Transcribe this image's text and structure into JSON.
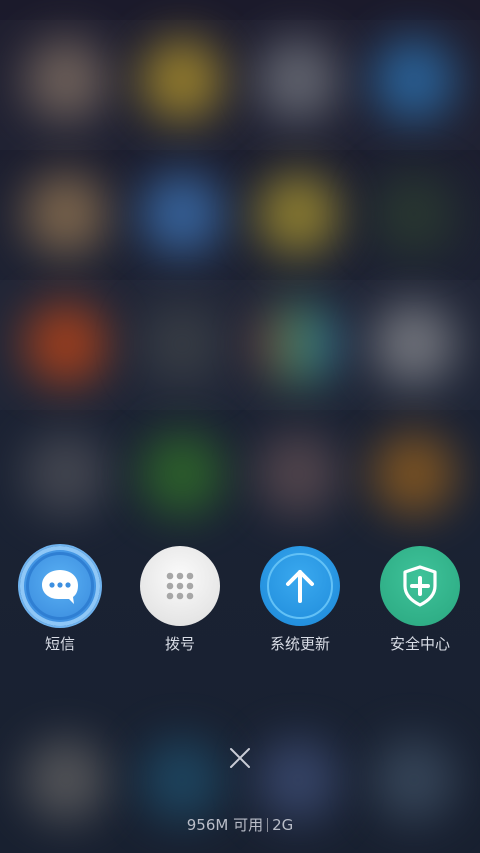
{
  "recent_apps": [
    {
      "label": "短信",
      "icon": "message-bubble-icon",
      "color": "#3d8fe0"
    },
    {
      "label": "拨号",
      "icon": "dialpad-icon",
      "color": "#e6e6e6"
    },
    {
      "label": "系统更新",
      "icon": "arrow-up-icon",
      "color": "#2390de"
    },
    {
      "label": "安全中心",
      "icon": "shield-plus-icon",
      "color": "#2fae86"
    }
  ],
  "close": {
    "label": "×",
    "icon": "close-icon"
  },
  "memory": {
    "available": "956M 可用",
    "total": "2G"
  }
}
